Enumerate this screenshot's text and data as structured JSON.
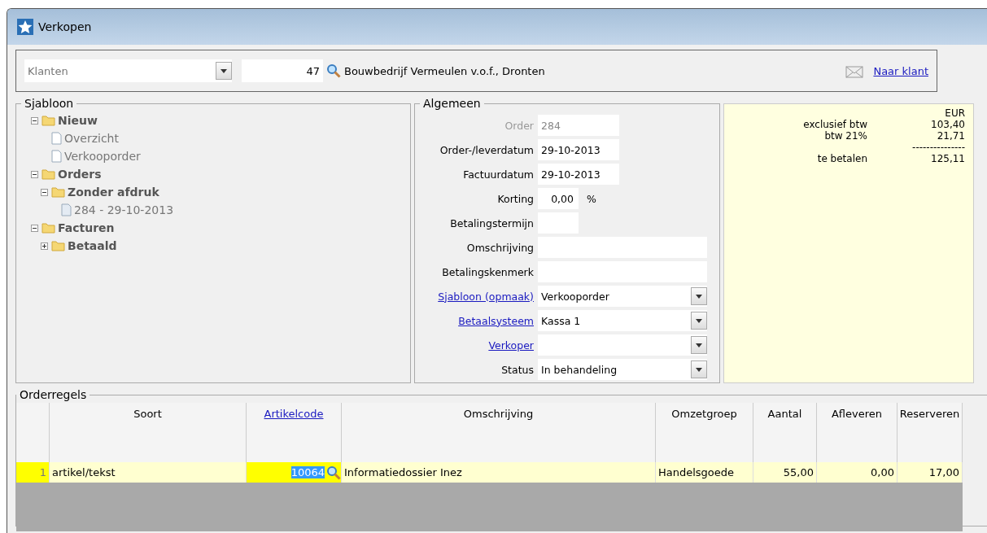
{
  "window": {
    "title": "Verkopen"
  },
  "customer_bar": {
    "type_select": "Klanten",
    "number": "47",
    "name": "Bouwbedrijf Vermeulen v.o.f., Dronten",
    "link": "Naar klant"
  },
  "template_tree": {
    "title": "Sjabloon",
    "items": [
      {
        "label": "Nieuw",
        "kind": "folder",
        "expanded": true,
        "children": [
          {
            "label": "Overzicht",
            "kind": "document"
          },
          {
            "label": "Verkooporder",
            "kind": "document"
          }
        ]
      },
      {
        "label": "Orders",
        "kind": "folder",
        "expanded": true,
        "children": [
          {
            "label": "Zonder afdruk",
            "kind": "folder",
            "expanded": true,
            "children": [
              {
                "label": "284 - 29-10-2013",
                "kind": "order"
              }
            ]
          }
        ]
      },
      {
        "label": "Facturen",
        "kind": "folder",
        "expanded": true,
        "children": [
          {
            "label": "Betaald",
            "kind": "folder",
            "expanded": false
          }
        ]
      }
    ]
  },
  "general": {
    "title": "Algemeen",
    "fields": [
      {
        "label": "Order",
        "value": "284",
        "kind": "short",
        "disabled": true,
        "link": false
      },
      {
        "label": "Order-/leverdatum",
        "value": "29-10-2013",
        "kind": "short",
        "disabled": false,
        "link": false
      },
      {
        "label": "Factuurdatum",
        "value": "29-10-2013",
        "kind": "short",
        "disabled": false,
        "link": false
      },
      {
        "label": "Korting",
        "value": "0,00",
        "suffix": "%",
        "kind": "tiny",
        "disabled": false,
        "link": false
      },
      {
        "label": "Betalingstermijn",
        "kind": "tiny",
        "disabled": false,
        "link": false
      },
      {
        "label": "Omschrijving",
        "kind": "wide",
        "disabled": false,
        "link": false
      },
      {
        "label": "Betalingskenmerk",
        "kind": "wide",
        "disabled": false,
        "link": false
      },
      {
        "label": "Sjabloon (opmaak)",
        "value": "Verkooporder",
        "kind": "dropdown",
        "disabled": false,
        "link": true
      },
      {
        "label": "Betaalsysteem",
        "value": "Kassa 1",
        "kind": "dropdown",
        "disabled": false,
        "link": true
      },
      {
        "label": "Verkoper",
        "kind": "dropdown",
        "disabled": false,
        "link": true
      },
      {
        "label": "Status",
        "value": "In behandeling",
        "kind": "dropdown",
        "disabled": false,
        "link": false
      }
    ]
  },
  "totals": {
    "currency": "EUR",
    "rows": [
      {
        "label": "exclusief btw",
        "value": "103,40",
        "kind": "line"
      },
      {
        "label": "btw 21%",
        "value": "21,71",
        "kind": "line"
      },
      {
        "value": "---------------",
        "kind": "separator"
      },
      {
        "label": "te betalen",
        "value": "125,11",
        "kind": "line"
      }
    ]
  },
  "order_lines": {
    "title": "Orderregels",
    "columns": [
      {
        "label": "Soort",
        "link": false
      },
      {
        "label": "Artikelcode",
        "link": true
      },
      {
        "label": "Omschrijving",
        "link": false
      },
      {
        "label": "Omzetgroep",
        "link": false
      },
      {
        "label": "Aantal",
        "link": false
      },
      {
        "label": "Afleveren",
        "link": false
      },
      {
        "label": "Reserveren",
        "link": false
      }
    ],
    "rows": [
      {
        "number": "1",
        "selected": true,
        "cells": [
          "artikel/tekst",
          "10064",
          "Informatiedossier Inez",
          "Handelsgoede",
          "55,00",
          "0,00",
          "17,00"
        ]
      }
    ]
  }
}
